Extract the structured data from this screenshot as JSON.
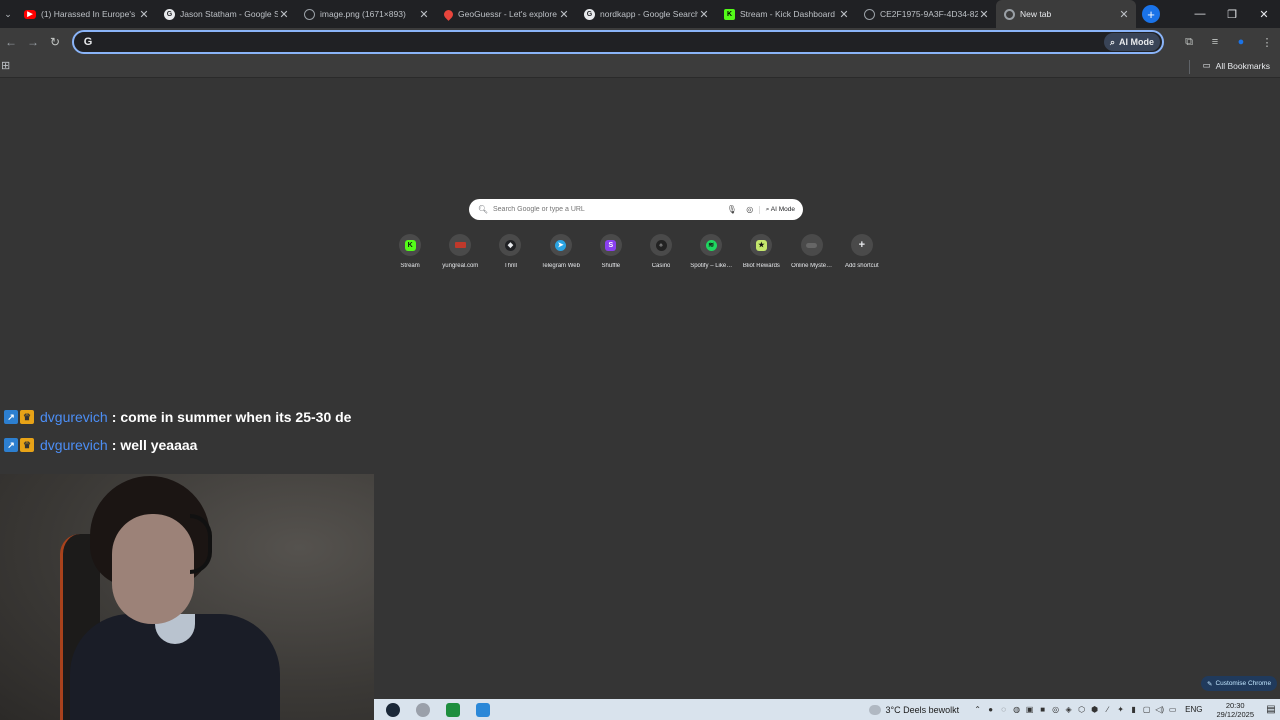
{
  "tabs": [
    {
      "title": "(1) Harassed In Europe's",
      "favicon": "youtube-icon",
      "color": "#ff0000"
    },
    {
      "title": "Jason Statham - Google S",
      "favicon": "google-icon",
      "color": "#e8eaed"
    },
    {
      "title": "image.png (1671×893)",
      "favicon": "globe-icon",
      "color": "#9aa0a6"
    },
    {
      "title": "GeoGuessr - Let's explore",
      "favicon": "map-pin-icon",
      "color": "#e8453c"
    },
    {
      "title": "nordkapp - Google Search",
      "favicon": "google-icon",
      "color": "#e8eaed"
    },
    {
      "title": "Stream - Kick Dashboard",
      "favicon": "kick-icon",
      "color": "#53fc18"
    },
    {
      "title": "CE2F1975-9A3F-4D34-82",
      "favicon": "globe-icon",
      "color": "#9aa0a6"
    },
    {
      "title": "New tab",
      "favicon": "chrome-icon",
      "color": "#9aa0a6",
      "active": true
    }
  ],
  "toolbar": {
    "omnibox_value": "",
    "ai_mode_label": "AI Mode"
  },
  "bookmarks": {
    "all_bookmarks_label": "All Bookmarks"
  },
  "ntp": {
    "search_placeholder": "Search Google or type a URL",
    "ai_mode_label": "AI Mode",
    "shortcuts": [
      {
        "label": "Stream",
        "color": "#53fc18",
        "glyph": "K"
      },
      {
        "label": "yungreal.com",
        "color": "#c0392b",
        "glyph": "▬"
      },
      {
        "label": "Thrill",
        "color": "#e8eaed",
        "glyph": "◆"
      },
      {
        "label": "Telegram Web",
        "color": "#2aa3e1",
        "glyph": "➤"
      },
      {
        "label": "Shuffle",
        "color": "#8a3ff0",
        "glyph": "S"
      },
      {
        "label": "Casino",
        "color": "#555555",
        "glyph": "♠"
      },
      {
        "label": "Spotify – Like…",
        "color": "#1ed760",
        "glyph": "≋"
      },
      {
        "label": "Bliot Rewards",
        "color": "#c5e86c",
        "glyph": "★"
      },
      {
        "label": "Online Myste…",
        "color": "#666666",
        "glyph": "▪▪"
      },
      {
        "label": "Add shortcut",
        "color": "#e8eaed",
        "glyph": "+"
      }
    ],
    "customise_label": "Customise Chrome"
  },
  "chat": [
    {
      "user": "dvgurevich",
      "message": "come in summer when its 25-30 de"
    },
    {
      "user": "dvgurevich",
      "message": "well yeaaaa"
    }
  ],
  "taskbar": {
    "weather": "3°C  Deels bewolkt",
    "language": "ENG",
    "time": "20:30",
    "date": "29/12/2025"
  }
}
